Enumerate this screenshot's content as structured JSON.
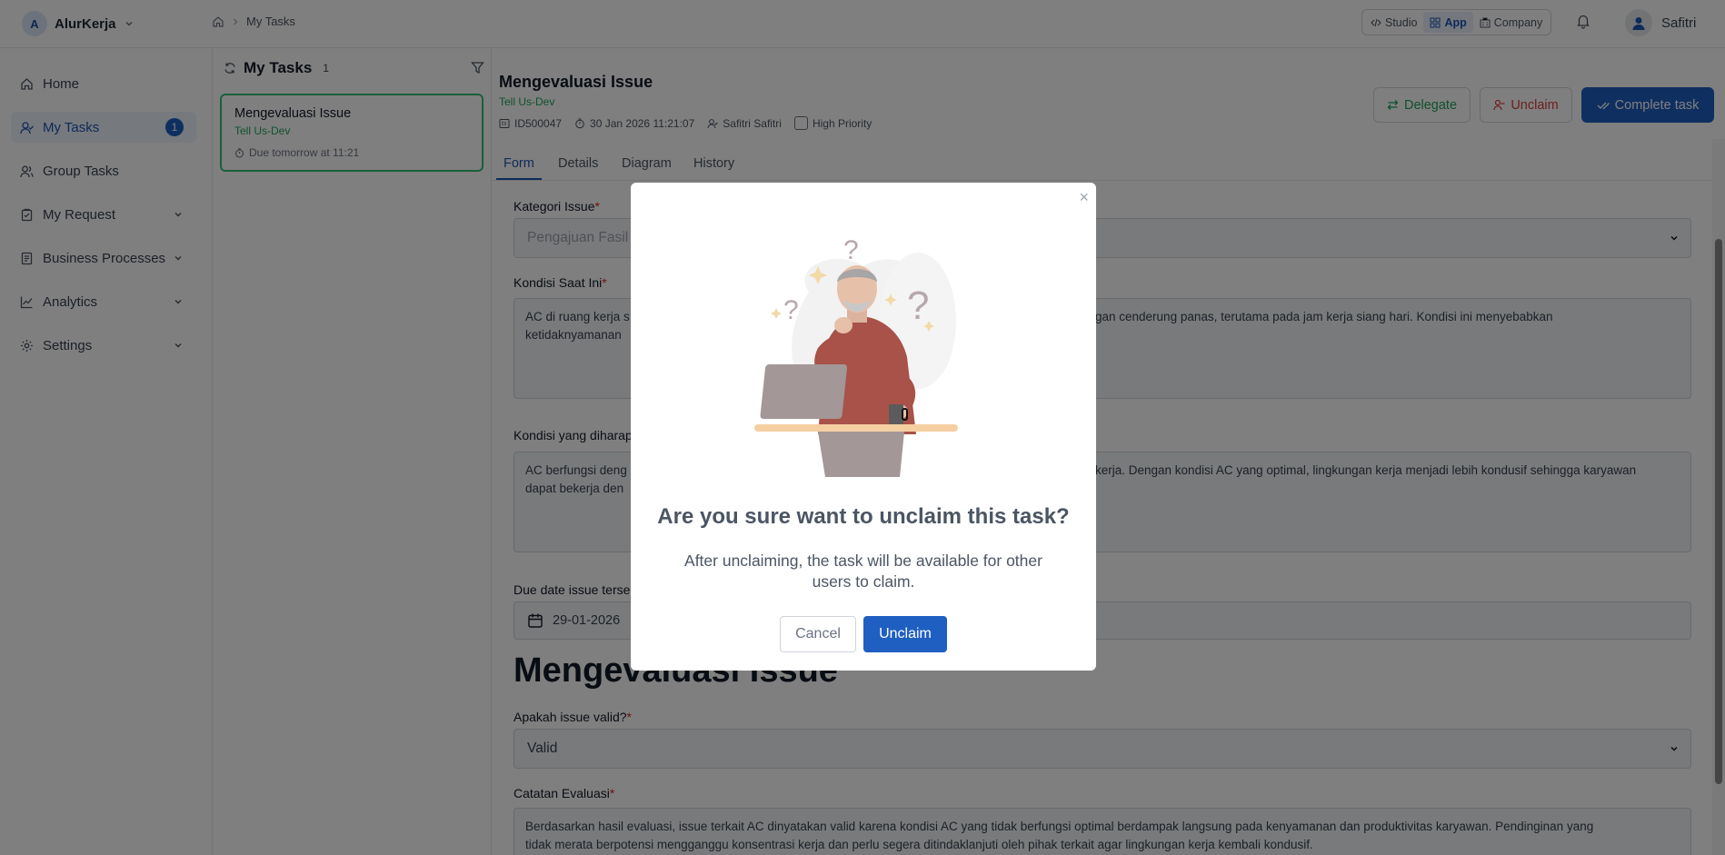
{
  "topbar": {
    "brand_initial": "A",
    "brand_name": "AlurKerja",
    "breadcrumb_current": "My Tasks",
    "modes": [
      "Studio",
      "App",
      "Company"
    ],
    "user_name": "Safitri"
  },
  "sidebar": {
    "items": [
      {
        "label": "Home"
      },
      {
        "label": "My Tasks",
        "badge": "1"
      },
      {
        "label": "Group Tasks"
      },
      {
        "label": "My Request"
      },
      {
        "label": "Business Processes"
      },
      {
        "label": "Analytics"
      },
      {
        "label": "Settings"
      }
    ]
  },
  "tasklist": {
    "title": "My Tasks",
    "count": "1",
    "card": {
      "title": "Mengevaluasi Issue",
      "subtitle": "Tell Us-Dev",
      "due": "Due tomorrow at 11:21"
    }
  },
  "task": {
    "title": "Mengevaluasi Issue",
    "subtitle": "Tell Us-Dev",
    "id": "ID500047",
    "datetime": "30 Jan 2026 11:21:07",
    "assignee": "Safitri Safitri",
    "priority_label": "High Priority",
    "delegate_label": "Delegate",
    "unclaim_label": "Unclaim",
    "complete_label": "Complete task"
  },
  "tabs": [
    "Form",
    "Details",
    "Diagram",
    "History"
  ],
  "form": {
    "kategori_label": "Kategori Issue",
    "kategori_value": "Pengajuan Fasil",
    "kondisi_label": "Kondisi Saat Ini",
    "kondisi_line1_left": "AC di ruang kerja s",
    "kondisi_line1_right": "gan cenderung panas, terutama pada jam kerja siang hari. Kondisi ini menyebabkan",
    "kondisi_line2": "ketidaknyamanan",
    "harapan_label": "Kondisi yang diharap",
    "harapan_line1_left": "AC berfungsi deng",
    "harapan_line1_right": "kerja. Dengan kondisi AC yang optimal, lingkungan kerja menjadi lebih kondusif sehingga karyawan",
    "harapan_line2": "dapat bekerja den",
    "due_label": "Due date issue terse",
    "due_value": "29-01-2026",
    "heading": "Mengevaluasi Issue",
    "valid_label": "Apakah issue valid?",
    "valid_value": "Valid",
    "catatan_label": "Catatan Evaluasi",
    "catatan_line1": "Berdasarkan hasil evaluasi, issue terkait AC dinyatakan valid karena kondisi AC yang tidak berfungsi optimal berdampak langsung pada kenyamanan dan produktivitas karyawan. Pendinginan yang",
    "catatan_line2": "tidak merata berpotensi mengganggu konsentrasi kerja dan perlu segera ditindaklanjuti oleh pihak terkait agar lingkungan kerja kembali kondusif."
  },
  "modal": {
    "close": "×",
    "title": "Are you sure want to unclaim this task?",
    "text": "After unclaiming, the task will be available for other users to claim.",
    "cancel_label": "Cancel",
    "unclaim_label": "Unclaim"
  },
  "colors": {
    "accent": "#1f5fc2",
    "success": "#22a35a",
    "danger": "#d94040"
  }
}
